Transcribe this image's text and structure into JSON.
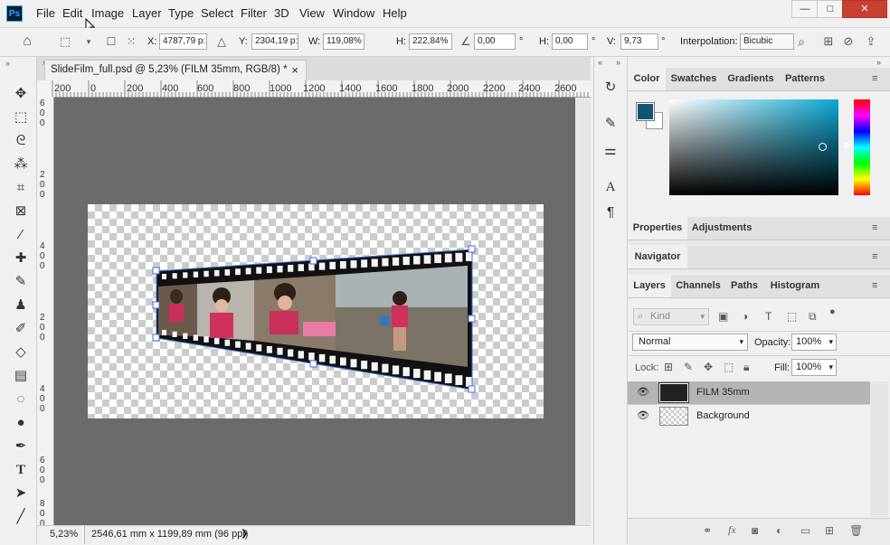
{
  "app": {
    "logo_text": "Ps"
  },
  "menu": [
    "File",
    "Edit",
    "Image",
    "Layer",
    "Type",
    "Select",
    "Filter",
    "3D",
    "View",
    "Window",
    "Help"
  ],
  "window_controls": {
    "minimize": "—",
    "maximize": "□",
    "close": "✕"
  },
  "options": {
    "x_label": "X:",
    "x_value": "4787,79 p:",
    "y_label": "Y:",
    "y_value": "2304,19 p:",
    "w_label": "W:",
    "w_value": "119,08%",
    "h_label": "H:",
    "h_value": "222,84%",
    "angle_value": "0,00",
    "hskew_label": "H:",
    "hskew_value": "0,00",
    "vskew_label": "V:",
    "vskew_value": "9,73",
    "degree": "°",
    "interp_label": "Interpolation:",
    "interp_value": "Bicubic"
  },
  "document": {
    "tab_title": "SlideFilm_full.psd @ 5,23% (FILM 35mm, RGB/8) *",
    "close": "×",
    "ruler_top": [
      "200",
      "0",
      "200",
      "400",
      "600",
      "800",
      "1000",
      "1200",
      "1400",
      "1600",
      "1800",
      "2000",
      "2200",
      "2400",
      "2600"
    ],
    "ruler_left": [
      "6",
      "0",
      "0",
      "2",
      "0",
      "0",
      "4",
      "0",
      "0",
      "2",
      "0",
      "0",
      "4",
      "0",
      "0",
      "6",
      "0",
      "0",
      "8",
      "0",
      "0"
    ],
    "zoom": "5,23%",
    "doc_size": "2546,61 mm x 1199,89 mm (96 ppi)",
    "status_arrow": "❯"
  },
  "panels": {
    "color_tabs": [
      "Color",
      "Swatches",
      "Gradients",
      "Patterns"
    ],
    "colors": {
      "foreground": "#0f5672",
      "background": "#ffffff"
    },
    "properties_tabs": [
      "Properties",
      "Adjustments"
    ],
    "navigator_tabs": [
      "Navigator"
    ],
    "layers_tabs": [
      "Layers",
      "Channels",
      "Paths",
      "Histogram"
    ],
    "kind_placeholder": "Kind",
    "blend_mode": "Normal",
    "opacity_label": "Opacity:",
    "opacity_value": "100%",
    "lock_label": "Lock:",
    "fill_label": "Fill:",
    "fill_value": "100%",
    "layers": [
      {
        "name": "FILM 35mm",
        "selected": true
      },
      {
        "name": "Background",
        "selected": false
      }
    ]
  }
}
